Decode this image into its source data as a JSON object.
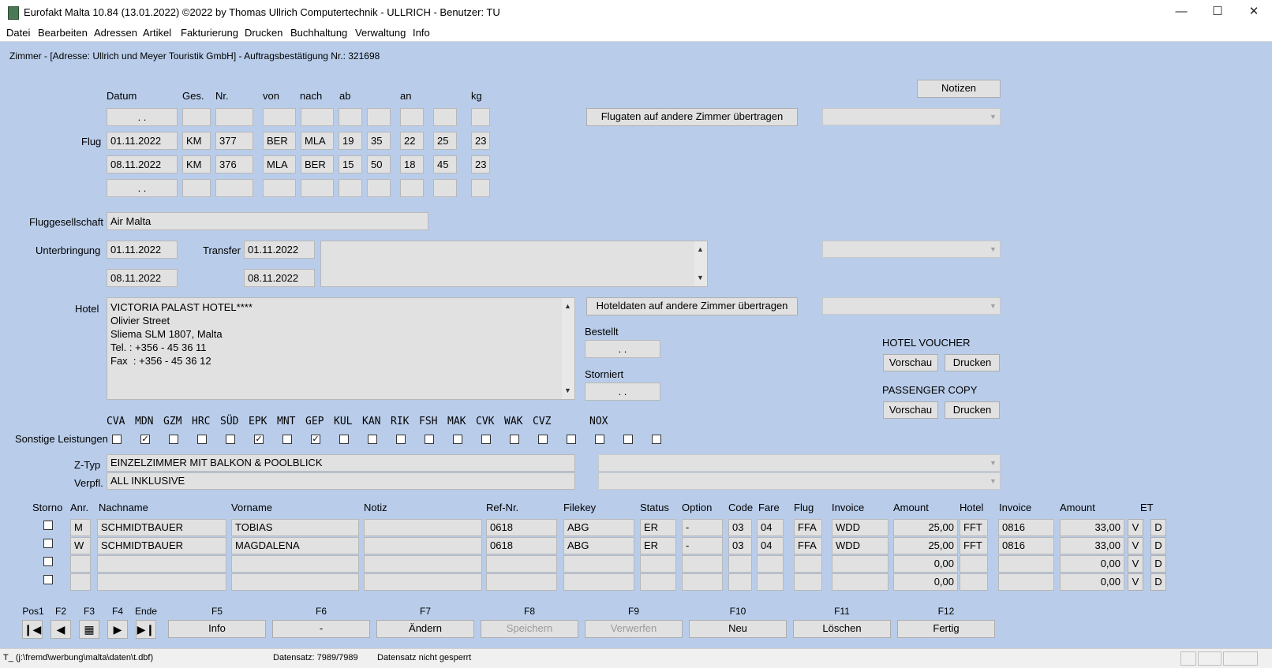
{
  "window": {
    "title": "Eurofakt Malta  10.84 (13.01.2022) ©2022 by Thomas Ullrich Computertechnik - ULLRICH - Benutzer: TU"
  },
  "menu": [
    "Datei",
    "Bearbeiten",
    "Adressen",
    "Artikel",
    "Fakturierung",
    "Drucken",
    "Buchhaltung",
    "Verwaltung",
    "Info"
  ],
  "subtitle": "Zimmer - [Adresse: Ullrich und Meyer Touristik GmbH] - Auftragsbestätigung Nr.: 321698",
  "flight_headers": {
    "datum": "Datum",
    "ges": "Ges.",
    "nr": "Nr.",
    "von": "von",
    "nach": "nach",
    "ab": "ab",
    "an": "an",
    "kg": "kg"
  },
  "flug_label": "Flug",
  "flights": [
    {
      "datum": ". .",
      "ges": "",
      "nr": "",
      "von": "",
      "nach": "",
      "ab_h": "",
      "ab_m": "",
      "an_h": "",
      "an_m": "",
      "kg": ""
    },
    {
      "datum": "01.11.2022",
      "ges": "KM",
      "nr": "377",
      "von": "BER",
      "nach": "MLA",
      "ab_h": "19",
      "ab_m": "35",
      "an_h": "22",
      "an_m": "25",
      "kg": "23"
    },
    {
      "datum": "08.11.2022",
      "ges": "KM",
      "nr": "376",
      "von": "MLA",
      "nach": "BER",
      "ab_h": "15",
      "ab_m": "50",
      "an_h": "18",
      "an_m": "45",
      "kg": "23"
    },
    {
      "datum": ". .",
      "ges": "",
      "nr": "",
      "von": "",
      "nach": "",
      "ab_h": "",
      "ab_m": "",
      "an_h": "",
      "an_m": "",
      "kg": ""
    }
  ],
  "buttons": {
    "notizen": "Notizen",
    "flugdaten_uebertragen": "Flugaten auf andere Zimmer übertragen",
    "hoteldaten_uebertragen": "Hoteldaten auf andere Zimmer übertragen",
    "vorschau": "Vorschau",
    "drucken": "Drucken"
  },
  "fluggesellschaft": {
    "label": "Fluggesellschaft",
    "value": "Air Malta"
  },
  "unterbringung": {
    "label": "Unterbringung",
    "from": "01.11.2022",
    "to": "08.11.2022"
  },
  "transfer": {
    "label": "Transfer",
    "from": "01.11.2022",
    "to": "08.11.2022"
  },
  "hotel": {
    "label": "Hotel",
    "lines": [
      "VICTORIA PALAST HOTEL****",
      "Olivier Street",
      "Sliema SLM 1807, Malta",
      "Tel. : +356 - 45 36 11",
      "Fax  : +356 - 45 36 12"
    ]
  },
  "bestellt": {
    "label": "Bestellt",
    "value": ". ."
  },
  "storniert": {
    "label": "Storniert",
    "value": ". ."
  },
  "hotel_voucher": "HOTEL VOUCHER",
  "passenger_copy": "PASSENGER COPY",
  "sonstige": {
    "label": "Sonstige Leistungen",
    "codes": [
      "CVA",
      "MDN",
      "GZM",
      "HRC",
      "SÜD",
      "EPK",
      "MNT",
      "GEP",
      "KUL",
      "KAN",
      "RIK",
      "FSH",
      "MAK",
      "CVK",
      "WAK",
      "CVZ",
      "",
      "NOX",
      "",
      ""
    ],
    "checked": [
      false,
      true,
      false,
      false,
      false,
      true,
      false,
      true,
      false,
      false,
      false,
      false,
      false,
      false,
      false,
      false,
      false,
      false,
      false,
      false
    ]
  },
  "ztyp": {
    "label": "Z-Typ",
    "value": "EINZELZIMMER MIT BALKON & POOLBLICK"
  },
  "verpfl": {
    "label": "Verpfl.",
    "value": "ALL INKLUSIVE"
  },
  "table": {
    "headers": {
      "storno": "Storno",
      "anr": "Anr.",
      "nachname": "Nachname",
      "vorname": "Vorname",
      "notiz": "Notiz",
      "refnr": "Ref-Nr.",
      "filekey": "Filekey",
      "status": "Status",
      "option": "Option",
      "code": "Code",
      "fare": "Fare",
      "flug": "Flug",
      "invoice1": "Invoice",
      "amount1": "Amount",
      "hotel": "Hotel",
      "invoice2": "Invoice",
      "amount2": "Amount",
      "et": "ET"
    },
    "rows": [
      {
        "anr": "M",
        "nachname": "SCHMIDTBAUER",
        "vorname": "TOBIAS",
        "notiz": "",
        "refnr": "0618",
        "filekey": "ABG",
        "status": "ER",
        "option": "-",
        "code": "03",
        "fare": "04",
        "flug": "FFA",
        "invoice1": "WDD",
        "amount1": "25,00",
        "hotel": "FFT",
        "invoice2": "0816",
        "amount2": "33,00",
        "v": "V",
        "d": "D"
      },
      {
        "anr": "W",
        "nachname": "SCHMIDTBAUER",
        "vorname": "MAGDALENA",
        "notiz": "",
        "refnr": "0618",
        "filekey": "ABG",
        "status": "ER",
        "option": "-",
        "code": "03",
        "fare": "04",
        "flug": "FFA",
        "invoice1": "WDD",
        "amount1": "25,00",
        "hotel": "FFT",
        "invoice2": "0816",
        "amount2": "33,00",
        "v": "V",
        "d": "D"
      },
      {
        "anr": "",
        "nachname": "",
        "vorname": "",
        "notiz": "",
        "refnr": "",
        "filekey": "",
        "status": "",
        "option": "",
        "code": "",
        "fare": "",
        "flug": "",
        "invoice1": "",
        "amount1": "0,00",
        "hotel": "",
        "invoice2": "",
        "amount2": "0,00",
        "v": "V",
        "d": "D"
      },
      {
        "anr": "",
        "nachname": "",
        "vorname": "",
        "notiz": "",
        "refnr": "",
        "filekey": "",
        "status": "",
        "option": "",
        "code": "",
        "fare": "",
        "flug": "",
        "invoice1": "",
        "amount1": "0,00",
        "hotel": "",
        "invoice2": "",
        "amount2": "0,00",
        "v": "V",
        "d": "D"
      }
    ]
  },
  "nav_keys": [
    "Pos1",
    "F2",
    "F3",
    "F4",
    "Ende"
  ],
  "fkeys": [
    {
      "key": "F5",
      "label": "Info",
      "enabled": true
    },
    {
      "key": "F6",
      "label": "-",
      "enabled": true
    },
    {
      "key": "F7",
      "label": "Ändern",
      "enabled": true
    },
    {
      "key": "F8",
      "label": "Speichern",
      "enabled": false
    },
    {
      "key": "F9",
      "label": "Verwerfen",
      "enabled": false
    },
    {
      "key": "F10",
      "label": "Neu",
      "enabled": true
    },
    {
      "key": "F11",
      "label": "Löschen",
      "enabled": true
    },
    {
      "key": "F12",
      "label": "Fertig",
      "enabled": true
    }
  ],
  "status": {
    "path": "T_ (j:\\fremd\\werbung\\malta\\daten\\t.dbf)",
    "datensatz": "Datensatz: 7989/7989",
    "gesperrt": "Datensatz nicht gesperrt"
  }
}
